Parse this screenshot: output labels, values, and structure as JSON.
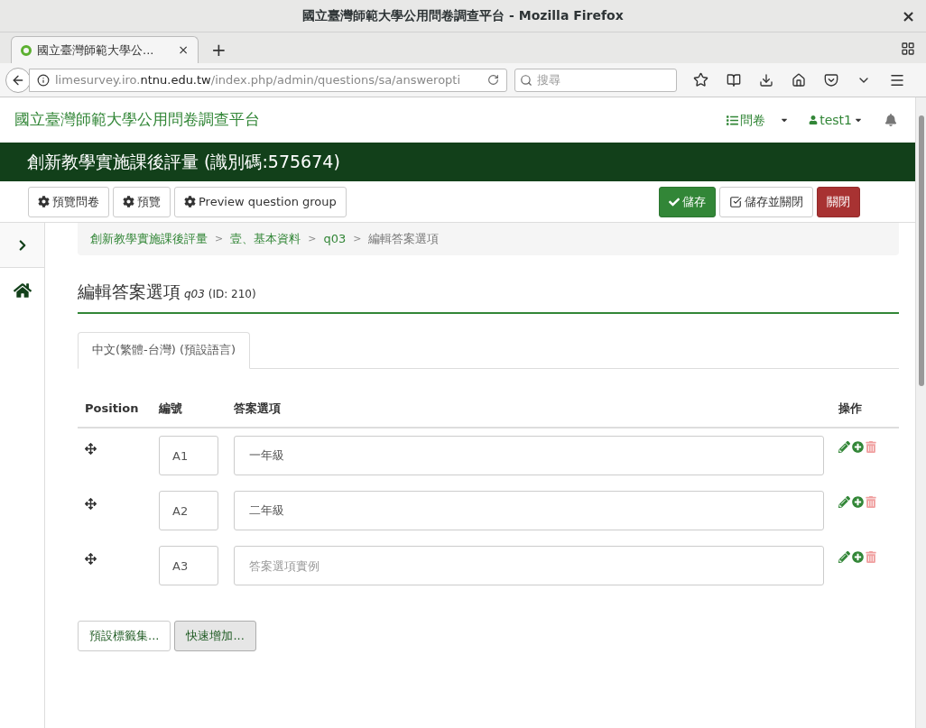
{
  "window": {
    "title": "國立臺灣師範大學公用問卷調查平台 - Mozilla Firefox",
    "close": "×"
  },
  "tabs": [
    {
      "label": "國立臺灣師範大學公...",
      "selected": true,
      "close": "×"
    }
  ],
  "new_tab": "+",
  "address_bar": {
    "prefix": "limesurvey.iro.",
    "domain": "ntnu.edu.tw",
    "path": "/index.php/admin/questions/sa/answeropti"
  },
  "search": {
    "placeholder": "搜尋"
  },
  "site": {
    "title": "國立臺灣師範大學公用問卷調查平台",
    "menu_surveys": "問卷",
    "user": "test1"
  },
  "survey_title": "創新教學實施課後評量 (識別碼:575674)",
  "toolbar": {
    "left": [
      {
        "label": "預覽問卷"
      },
      {
        "label": "預覽"
      },
      {
        "label": "Preview question group"
      }
    ],
    "right": [
      {
        "label": "儲存",
        "kind": "save"
      },
      {
        "label": "儲存並關閉",
        "kind": "save_close"
      },
      {
        "label": "關閉",
        "kind": "close"
      }
    ]
  },
  "breadcrumb": [
    {
      "label": "創新教學實施課後評量",
      "current": false
    },
    {
      "label": "壹、基本資料",
      "current": false
    },
    {
      "label": "q03",
      "current": false
    },
    {
      "label": "編輯答案選項",
      "current": true
    }
  ],
  "breadcrumb_separator": ">",
  "heading": {
    "title": "編輯答案選項",
    "code": "q03",
    "id": "(ID: 210)"
  },
  "language_tabs": [
    {
      "label": "中文(繁體-台灣) (預設語言)",
      "selected": true
    }
  ],
  "table": {
    "columns": [
      "Position",
      "編號",
      "答案選項",
      "操作"
    ],
    "rows": [
      {
        "code": "A1",
        "answer": "一年級"
      },
      {
        "code": "A2",
        "answer": "二年級"
      },
      {
        "code": "A3",
        "placeholder": "答案選項實例"
      }
    ]
  },
  "buttons": [
    {
      "label": "預設標籤集...",
      "hovered": false
    },
    {
      "label": "快速增加...",
      "hovered": true
    }
  ]
}
